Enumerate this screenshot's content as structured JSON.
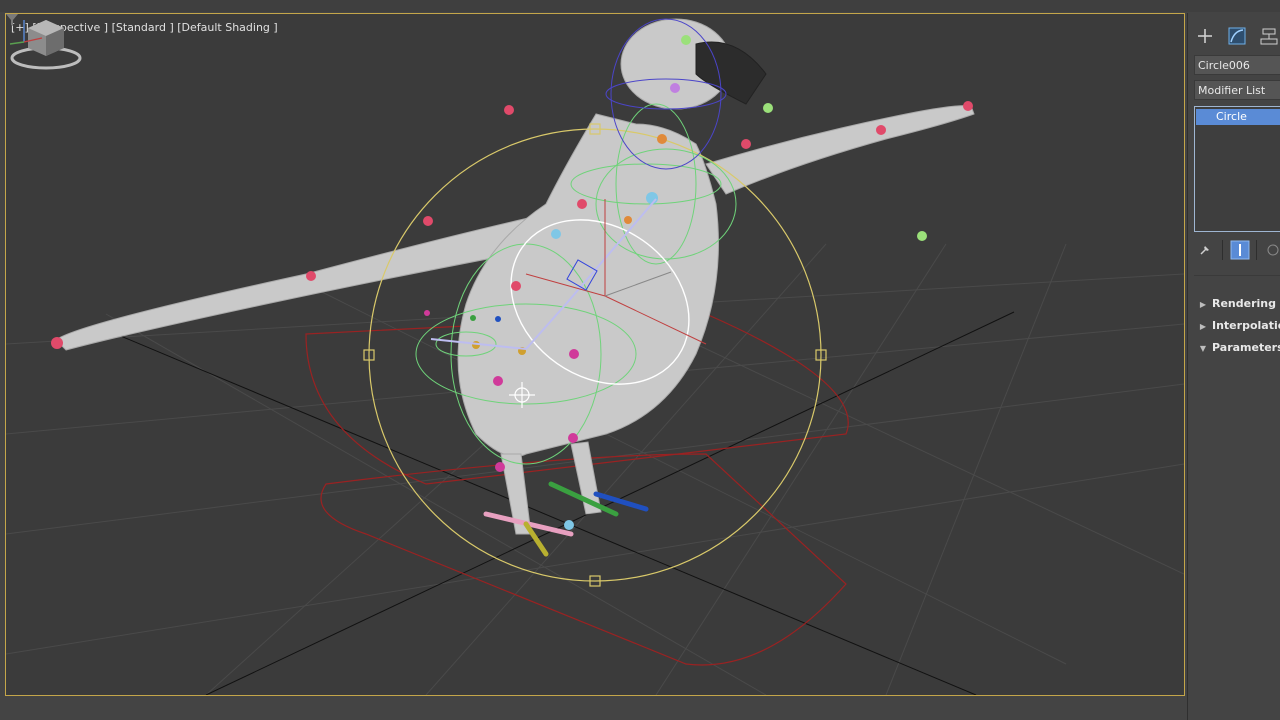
{
  "viewport": {
    "label_parts": [
      "[+]",
      "[Perspective ]",
      "[Standard ]",
      "[Default Shading ]"
    ],
    "filter_icon": "funnel-icon",
    "viewcube_icon": "viewcube-icon",
    "axis_icon": "axis-tripod-icon",
    "active_border_color": "#c4a64a",
    "scene_objects": [
      "bird-mesh",
      "biped-rig",
      "selected-circle-control"
    ]
  },
  "command_panel": {
    "tabs": [
      "create-tab-icon",
      "modify-tab-icon",
      "hierarchy-tab-icon"
    ],
    "object_name": "Circle006",
    "modifier_list_label": "Modifier List",
    "stack_items": [
      "Circle"
    ],
    "stack_tools": [
      "pin-stack-icon",
      "show-end-result-icon",
      "make-unique-icon"
    ],
    "rollouts": [
      {
        "label": "Rendering",
        "state": "collapsed"
      },
      {
        "label": "Interpolation",
        "state": "collapsed"
      },
      {
        "label": "Parameters",
        "state": "expanded"
      }
    ]
  },
  "colors": {
    "selection_blue": "#5a8bd6",
    "rig_yellow": "#d9c96a",
    "rig_green": "#6fd37a",
    "rig_red": "#b03030"
  }
}
